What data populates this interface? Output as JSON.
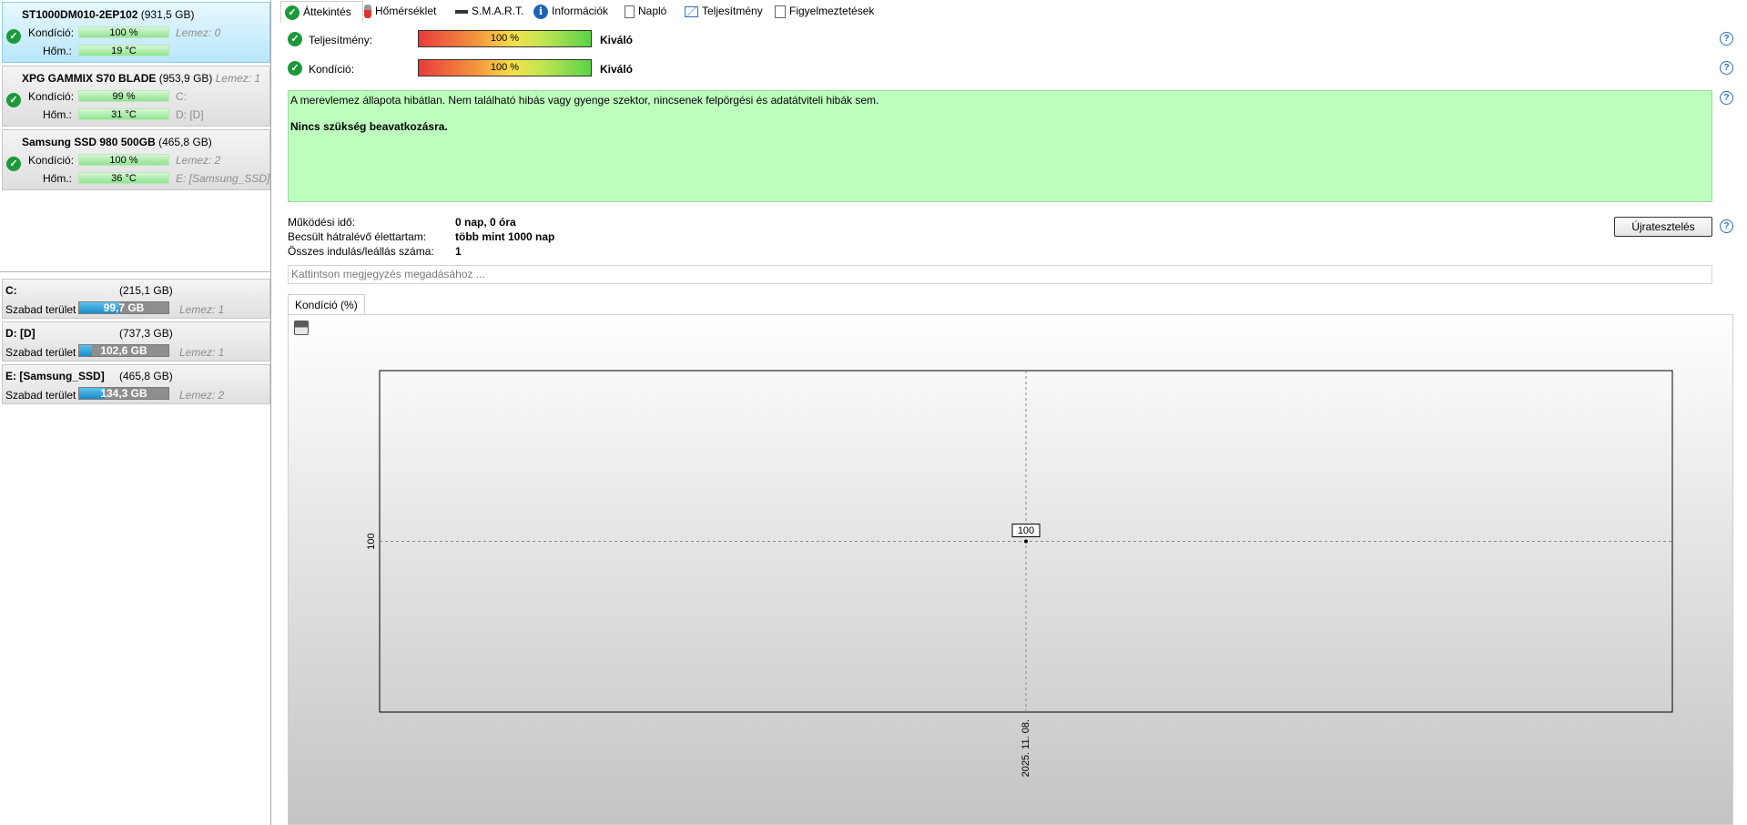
{
  "disks": [
    {
      "name": "ST1000DM010-2EP102",
      "size": "(931,5 GB)",
      "cond_label": "Kondíció:",
      "cond_value": "100 %",
      "temp_label": "Hőm.:",
      "temp_value": "19 °C",
      "meta1": "Lemez: 0",
      "meta2": ""
    },
    {
      "name": "XPG GAMMIX S70 BLADE",
      "size": "(953,9 GB)",
      "extra": "Lemez: 1",
      "cond_label": "Kondíció:",
      "cond_value": "99 %",
      "temp_label": "Hőm.:",
      "temp_value": "31 °C",
      "meta1": "C:",
      "meta2": "D: [D]"
    },
    {
      "name": "Samsung SSD 980 500GB",
      "size": "(465,8 GB)",
      "cond_label": "Kondíció:",
      "cond_value": "100 %",
      "temp_label": "Hőm.:",
      "temp_value": "36 °C",
      "meta1": "Lemez: 2",
      "meta2": "E: [Samsung_SSD]"
    }
  ],
  "volumes": [
    {
      "name": "C:",
      "size": "(215,1 GB)",
      "free_label": "Szabad terület",
      "free_value": "99,7 GB",
      "free_fraction": 0.46,
      "disk": "Lemez: 1"
    },
    {
      "name": "D: [D]",
      "size": "(737,3 GB)",
      "free_label": "Szabad terület",
      "free_value": "102,6 GB",
      "free_fraction": 0.14,
      "disk": "Lemez: 1"
    },
    {
      "name": "E: [Samsung_SSD]",
      "size": "(465,8 GB)",
      "free_label": "Szabad terület",
      "free_value": "134,3 GB",
      "free_fraction": 0.29,
      "disk": "Lemez: 2"
    }
  ],
  "tabs": [
    "Áttekintés",
    "Hőmérséklet",
    "S.M.A.R.T.",
    "Információk",
    "Napló",
    "Teljesítmény",
    "Figyelmeztetések"
  ],
  "overview": {
    "perf_label": "Teljesítmény:",
    "perf_value": "100 %",
    "perf_rating": "Kiváló",
    "cond_label": "Kondíció:",
    "cond_value": "100 %",
    "cond_rating": "Kiváló",
    "message": "A merevlemez állapota hibátlan. Nem található hibás vagy gyenge szektor, nincsenek felpörgési és adatátviteli hibák sem.",
    "message_bold": "Nincs szükség beavatkozásra.",
    "uptime_label": "Működési idő:",
    "uptime_value": "0 nap, 0 óra",
    "life_label": "Becsült hátralévő élettartam:",
    "life_value": "több mint 1000 nap",
    "starts_label": "Összes indulás/leállás száma:",
    "starts_value": "1",
    "retest_button": "Újratesztelés",
    "note_placeholder": "Kattintson megjegyzés megadásához ..."
  },
  "chart_tab": "Kondíció  (%)",
  "chart_data": {
    "type": "line",
    "x": [
      "2025. 11. 08."
    ],
    "series": [
      {
        "values": [
          100
        ]
      }
    ],
    "data_labels": [
      "100"
    ],
    "ytick_labels": [
      "100"
    ],
    "xtick_labels": [
      "2025. 11. 08."
    ]
  },
  "colors": {
    "good": "#1c9a3a",
    "message_bg": "#bdffbd",
    "accent": "#1b8bc9"
  }
}
